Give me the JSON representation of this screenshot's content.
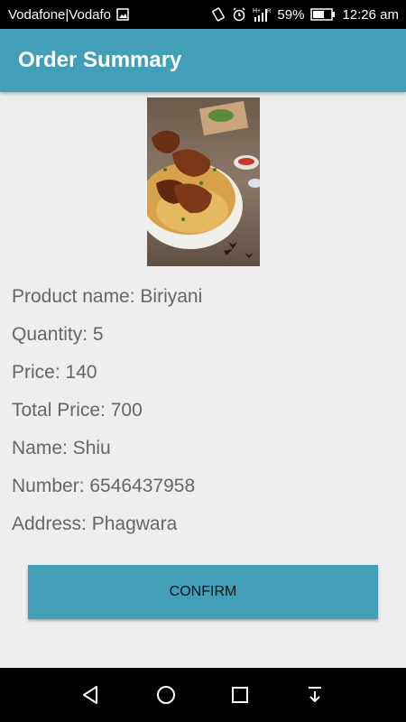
{
  "status_bar": {
    "carrier": "Vodafone|Vodafo",
    "battery": "59%",
    "time": "12:26 am",
    "icons": [
      "image-icon",
      "vibrate-icon",
      "alarm-icon",
      "signal-icon",
      "battery-icon"
    ]
  },
  "app_bar": {
    "title": "Order Summary"
  },
  "product_image": {
    "description_icon": "biryani-photo"
  },
  "details": [
    "Product name: Biriyani",
    "Quantity: 5",
    "Price: 140",
    "Total Price: 700",
    "Name: Shiu",
    "Number: 6546437958",
    "Address: Phagwara"
  ],
  "confirm_button": {
    "label": "CONFIRM"
  },
  "nav_bar": {
    "icons": [
      "back-icon",
      "home-icon",
      "recents-icon",
      "notification-pull-icon"
    ]
  },
  "colors": {
    "accent": "#439fb8",
    "background": "#eeeeee",
    "text": "#666666"
  }
}
